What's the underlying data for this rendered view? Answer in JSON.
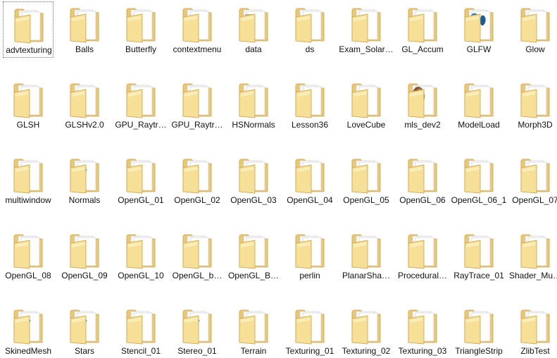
{
  "window": {
    "view": "Large Icons"
  },
  "colors": {
    "folder_back": "#e9c877",
    "folder_front": "#f6df97",
    "folder_edge": "#c9a24a",
    "paper": "#fbfbfb",
    "paper_edge": "#c8c8c8",
    "doc_mark": "#3f9a8f"
  },
  "folders": [
    {
      "name": "advtexturing",
      "selected": true,
      "icon": "folder-icon"
    },
    {
      "name": "Balls",
      "icon": "folder-icon"
    },
    {
      "name": "Butterfly",
      "icon": "folder-icon"
    },
    {
      "name": "contextmenu",
      "icon": "folder-icon"
    },
    {
      "name": "data",
      "icon": "folder-icon",
      "preview": "texture"
    },
    {
      "name": "ds",
      "icon": "folder-icon"
    },
    {
      "name": "Exam_Solar…",
      "icon": "folder-icon"
    },
    {
      "name": "GL_Accum",
      "icon": "folder-icon"
    },
    {
      "name": "GLFW",
      "icon": "folder-icon",
      "preview": "glfw"
    },
    {
      "name": "Glow",
      "icon": "folder-icon"
    },
    {
      "name": "GLSH",
      "icon": "folder-icon"
    },
    {
      "name": "GLSHv2.0",
      "icon": "folder-icon"
    },
    {
      "name": "GPU_Raytr…",
      "icon": "folder-icon"
    },
    {
      "name": "GPU_Raytr…",
      "icon": "folder-icon"
    },
    {
      "name": "HSNormals",
      "icon": "folder-icon"
    },
    {
      "name": "Lesson36",
      "icon": "folder-icon"
    },
    {
      "name": "LoveCube",
      "icon": "folder-icon"
    },
    {
      "name": "mls_dev2",
      "icon": "folder-icon",
      "preview": "photo"
    },
    {
      "name": "ModelLoad",
      "icon": "folder-icon"
    },
    {
      "name": "Morph3D",
      "icon": "folder-icon"
    },
    {
      "name": "multiwindow",
      "icon": "folder-icon"
    },
    {
      "name": "Normals",
      "icon": "folder-icon",
      "preview": "sketch"
    },
    {
      "name": "OpenGL_01",
      "icon": "folder-icon"
    },
    {
      "name": "OpenGL_02",
      "icon": "folder-icon"
    },
    {
      "name": "OpenGL_03",
      "icon": "folder-icon"
    },
    {
      "name": "OpenGL_04",
      "icon": "folder-icon"
    },
    {
      "name": "OpenGL_05",
      "icon": "folder-icon"
    },
    {
      "name": "OpenGL_06",
      "icon": "folder-icon"
    },
    {
      "name": "OpenGL_06_1",
      "icon": "folder-icon"
    },
    {
      "name": "OpenGL_07",
      "icon": "folder-icon"
    },
    {
      "name": "OpenGL_08",
      "icon": "folder-icon"
    },
    {
      "name": "OpenGL_09",
      "icon": "folder-icon"
    },
    {
      "name": "OpenGL_10",
      "icon": "folder-icon"
    },
    {
      "name": "OpenGL_b…",
      "icon": "folder-icon"
    },
    {
      "name": "OpenGL_B…",
      "icon": "folder-icon"
    },
    {
      "name": "perlin",
      "icon": "folder-icon"
    },
    {
      "name": "PlanarSha…",
      "icon": "folder-icon"
    },
    {
      "name": "Procedural…",
      "icon": "folder-icon"
    },
    {
      "name": "RayTrace_01",
      "icon": "folder-icon"
    },
    {
      "name": "Shader_Mu…",
      "icon": "folder-icon"
    },
    {
      "name": "SkinedMesh",
      "icon": "folder-icon",
      "preview": "sketch"
    },
    {
      "name": "Stars",
      "icon": "folder-icon",
      "preview": "sketch"
    },
    {
      "name": "Stencil_01",
      "icon": "folder-icon"
    },
    {
      "name": "Stereo_01",
      "icon": "folder-icon",
      "preview": "sketch"
    },
    {
      "name": "Terrain",
      "icon": "folder-icon",
      "preview": "empty"
    },
    {
      "name": "Texturing_01",
      "icon": "folder-icon"
    },
    {
      "name": "Texturing_02",
      "icon": "folder-icon"
    },
    {
      "name": "Texturing_03",
      "icon": "folder-icon"
    },
    {
      "name": "TriangleStrip",
      "icon": "folder-icon"
    },
    {
      "name": "ZlibTest",
      "icon": "folder-icon"
    }
  ]
}
